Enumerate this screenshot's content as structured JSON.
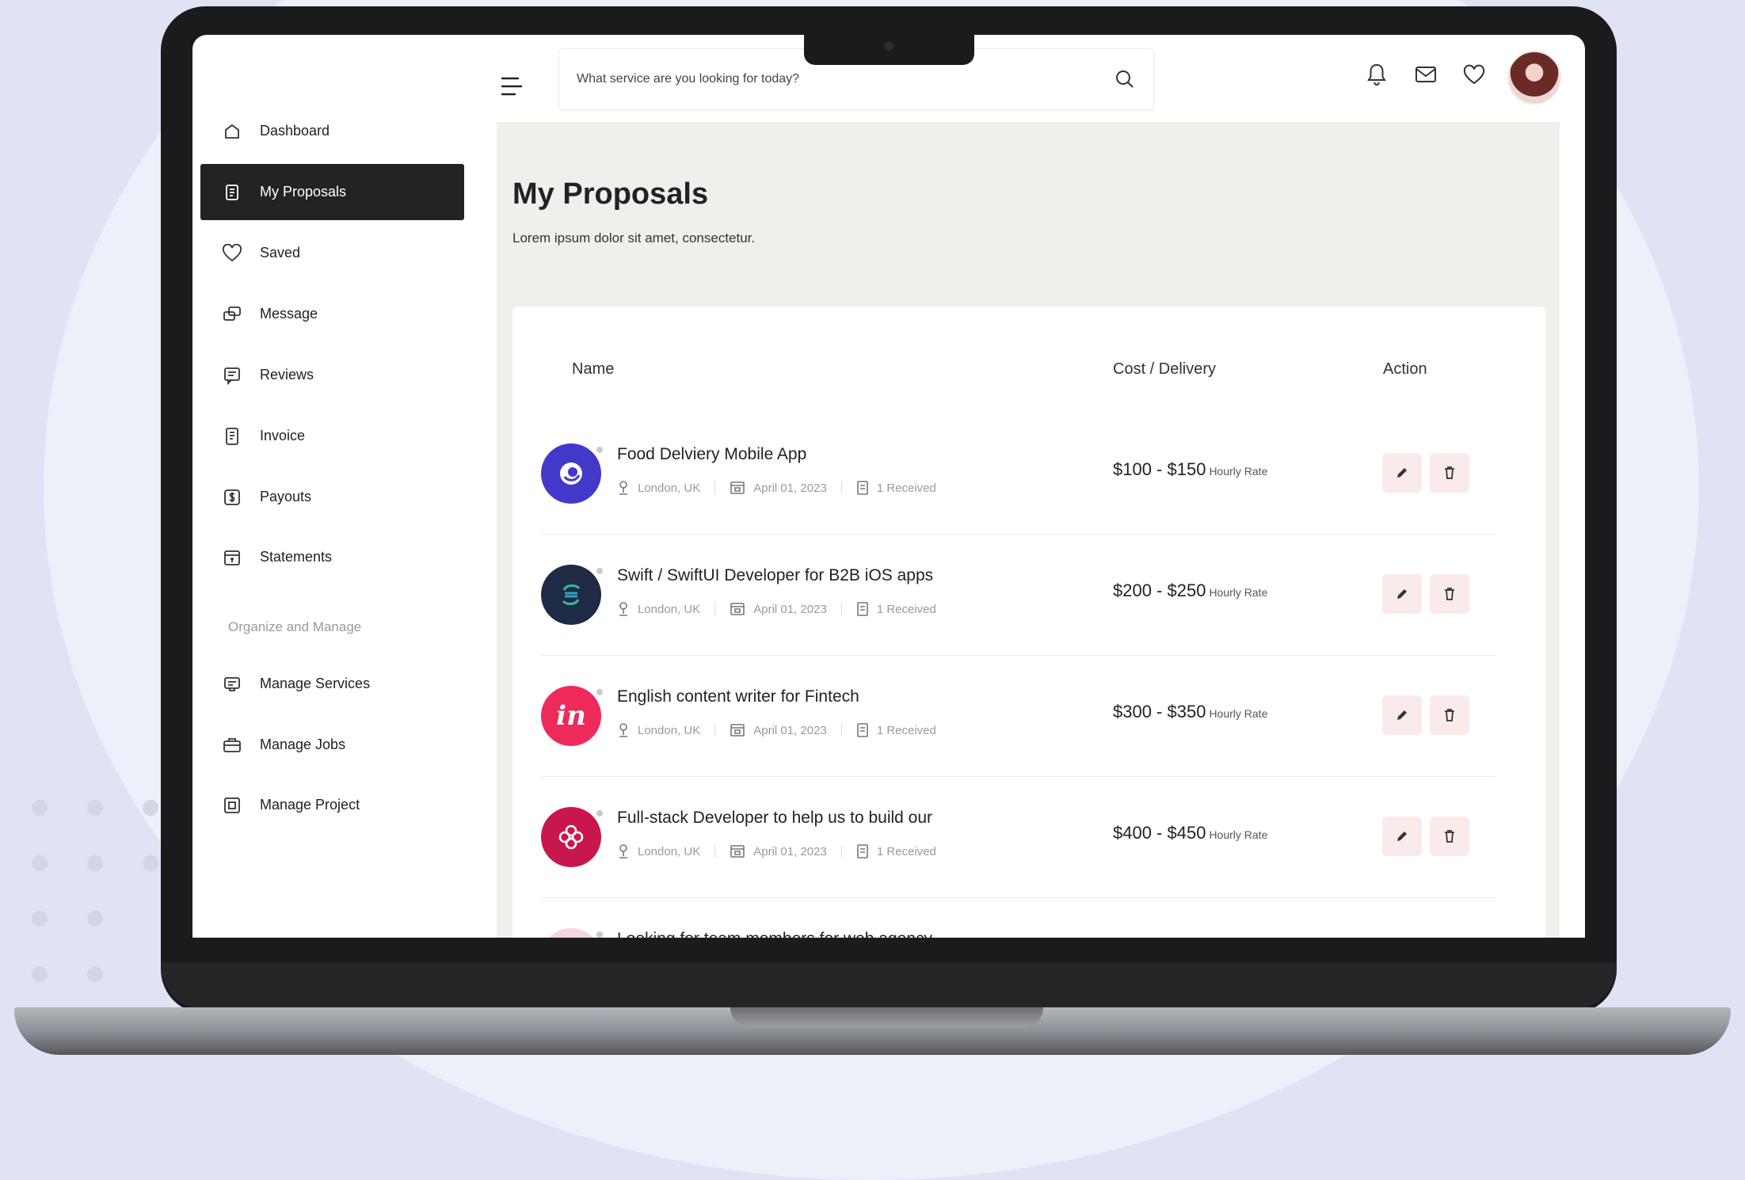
{
  "sidebar": {
    "items": [
      {
        "label": "Dashboard"
      },
      {
        "label": "My Proposals"
      },
      {
        "label": "Saved"
      },
      {
        "label": "Message"
      },
      {
        "label": "Reviews"
      },
      {
        "label": "Invoice"
      },
      {
        "label": "Payouts"
      },
      {
        "label": "Statements"
      }
    ],
    "section_heading": "Organize and Manage",
    "manage_items": [
      {
        "label": "Manage Services"
      },
      {
        "label": "Manage Jobs"
      },
      {
        "label": "Manage Project"
      }
    ]
  },
  "search": {
    "placeholder": "What service are you looking for today?"
  },
  "page": {
    "title": "My Proposals",
    "subtitle": "Lorem ipsum dolor sit amet, consectetur."
  },
  "table": {
    "headers": {
      "name": "Name",
      "cost": "Cost / Delivery",
      "action": "Action"
    },
    "rows": [
      {
        "title": "Food Delviery Mobile App",
        "location": "London, UK",
        "date": "April 01, 2023",
        "received": "1 Received",
        "price": "$100 - $150",
        "rate": "Hourly Rate",
        "logo_color": "#4338ca"
      },
      {
        "title": "Swift / SwiftUI Developer for B2B iOS apps",
        "location": "London, UK",
        "date": "April 01, 2023",
        "received": "1 Received",
        "price": "$200 - $250",
        "rate": "Hourly Rate",
        "logo_color": "#1f2b45"
      },
      {
        "title": "English content writer for Fintech",
        "location": "London, UK",
        "date": "April 01, 2023",
        "received": "1 Received",
        "price": "$300 - $350",
        "rate": "Hourly Rate",
        "logo_color": "#ee2a5b",
        "logo_text": "in"
      },
      {
        "title": "Full-stack Developer to help us to build our",
        "location": "London, UK",
        "date": "April 01, 2023",
        "received": "1 Received",
        "price": "$400 - $450",
        "rate": "Hourly Rate",
        "logo_color": "#c9174d"
      },
      {
        "title": "Looking for team members for web agency"
      }
    ]
  },
  "colors": {
    "active_nav_bg": "#232323",
    "main_bg": "#f1efec",
    "action_button_bg": "#fbeaea"
  }
}
